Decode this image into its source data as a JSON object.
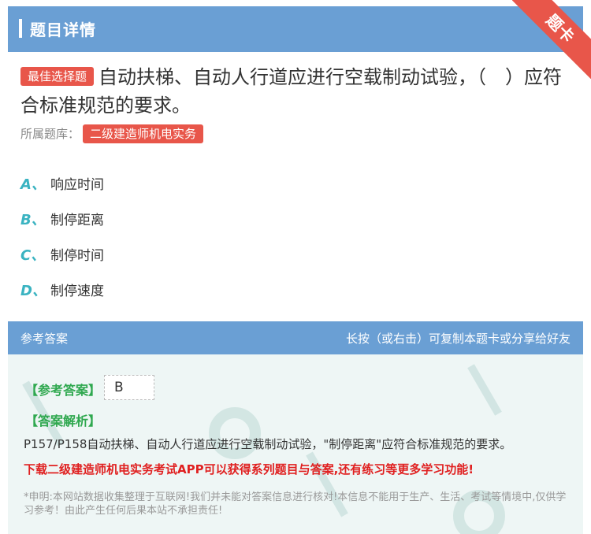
{
  "header": {
    "title": "题目详情"
  },
  "ribbon": {
    "label": "题卡"
  },
  "question": {
    "tag": "最佳选择题",
    "text": "自动扶梯、自动人行道应进行空载制动试验，（　）应符合标准规范的要求。"
  },
  "bank": {
    "label": "所属题库：",
    "name": "二级建造师机电实务"
  },
  "options": [
    {
      "letter": "A、",
      "text": "响应时间"
    },
    {
      "letter": "B、",
      "text": "制停距离"
    },
    {
      "letter": "C、",
      "text": "制停时间"
    },
    {
      "letter": "D、",
      "text": "制停速度"
    }
  ],
  "answer": {
    "head_left": "参考答案",
    "head_right": "长按（或右击）可复制本题卡或分享给好友",
    "ref_label": "【参考答案】",
    "ref_value": "B",
    "analysis_label": "【答案解析】",
    "analysis_text": "P157/P158自动扶梯、自动人行道应进行空载制动试验，\"制停距离\"应符合标准规范的要求。",
    "promo": "下载二级建造师机电实务考试APP可以获得系列题目与答案,还有练习等更多学习功能!",
    "disclaimer": "*申明:本网站数据收集整理于互联网!我们并未能对答案信息进行核对!本信息不能用于生产、生活、考试等情境中,仅供学习参考！由此产生任何后果本站不承担责任!"
  },
  "colors": {
    "accent_blue": "#6a9fd4",
    "tag_red": "#e8564a",
    "option_teal": "#3ab3c1",
    "label_green": "#2fa84f"
  }
}
